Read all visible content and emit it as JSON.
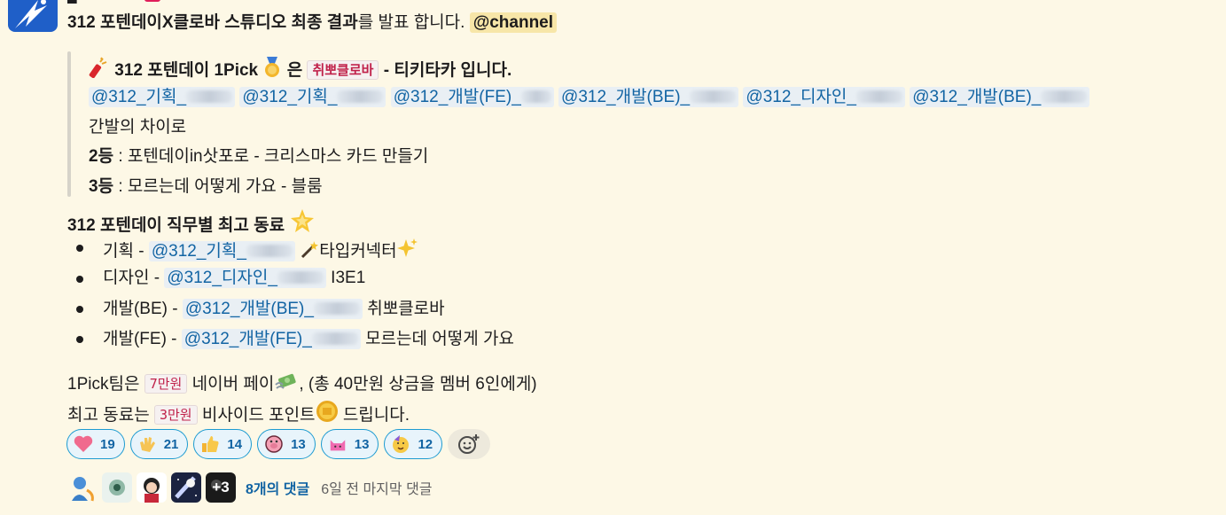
{
  "message": {
    "header_line": {
      "title_bold": "312 포텐데이X클로바 스튜디오 최종 결과",
      "title_rest": "를 발표 합니다.",
      "mention": "@channel"
    },
    "quote": {
      "winner_line": {
        "text_a": "312 포텐데이 1Pick",
        "text_b": "은",
        "code": "취뽀클로바",
        "text_c": "- 티키타카 입니다."
      },
      "winner_mentions": [
        "@312_기획_",
        "@312_기획_",
        "@312_개발(FE)_",
        "@312_개발(BE)_",
        "@312_디자인_",
        "@312_개발(BE)_"
      ],
      "gap_line": "간발의 차이로",
      "second": {
        "rank": "2등",
        "text": " : 포텐데이in삿포로 - 크리스마스 카드 만들기"
      },
      "third": {
        "rank": "3등",
        "text": " : 모르는데 어떻게 가요 - 블룸"
      }
    },
    "best_title": "312 포텐데이 직무별 최고 동료",
    "best_list": [
      {
        "role": "기획 - ",
        "mention": "@312_기획_",
        "team": "타입커넥터"
      },
      {
        "role": "디자인 - ",
        "mention": "@312_디자인_",
        "team": "I3E1"
      },
      {
        "role": "개발(BE) - ",
        "mention": "@312_개발(BE)_",
        "team": "취뽀클로바"
      },
      {
        "role": "개발(FE) - ",
        "mention": "@312_개발(FE)_",
        "team": "모르는데 어떻게 가요"
      }
    ],
    "prize1": {
      "a": "1Pick팀은",
      "code": "7만원",
      "b": "네이버 페이",
      "c": ", (총 40만원 상금을 멤버 6인에게)"
    },
    "prize2": {
      "a": "최고 동료는",
      "code": "3만원",
      "b": "비사이드 포인트",
      "c": "드립니다."
    }
  },
  "reactions": [
    {
      "icon": "heart-icon",
      "count": "19"
    },
    {
      "icon": "clap-icon",
      "count": "21"
    },
    {
      "icon": "thumbs-up-icon",
      "count": "14"
    },
    {
      "icon": "pig-icon",
      "count": "13"
    },
    {
      "icon": "pink-cat-icon",
      "count": "13"
    },
    {
      "icon": "party-face-icon",
      "count": "12"
    }
  ],
  "thread": {
    "more_avatars": "+3",
    "reply_count": "8개의 댓글",
    "last_reply": "6일 전 마지막 댓글"
  },
  "colors": {
    "link": "#1264a3",
    "code": "#c0214a",
    "mention_here_bg": "#f7e6a8",
    "background": "#fdf8e6"
  }
}
